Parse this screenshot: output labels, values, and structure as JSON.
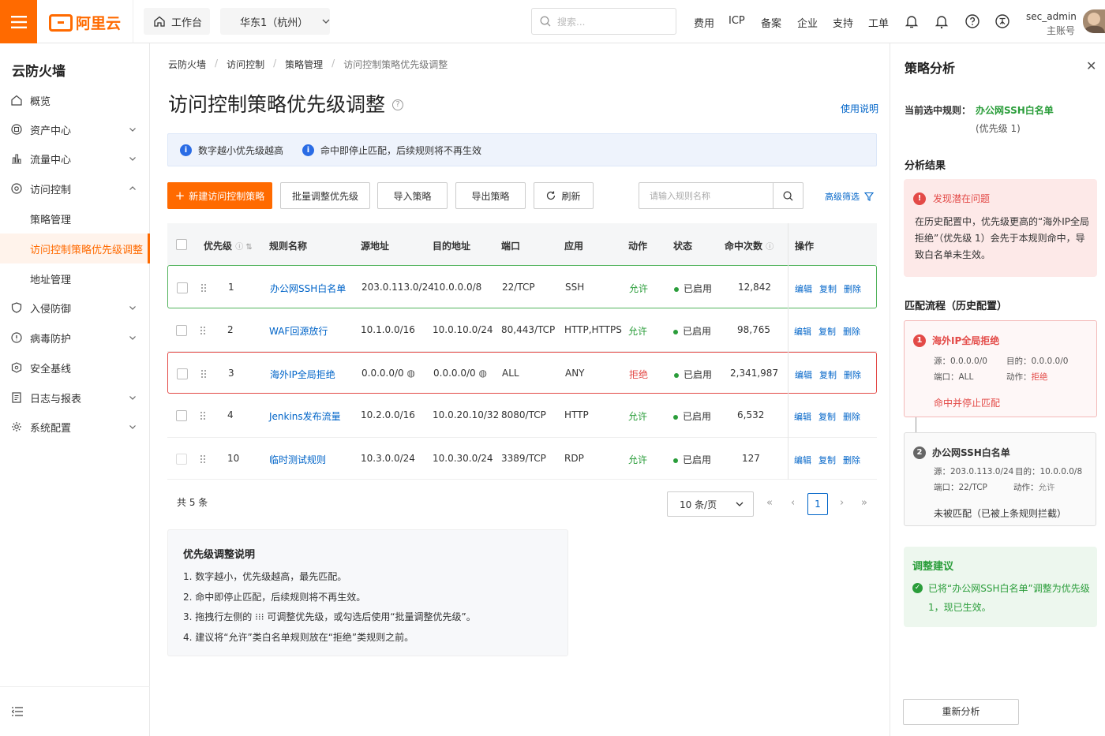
{
  "topbar": {
    "brand": "阿里云",
    "workbench": "工作台",
    "region": "华东1（杭州）",
    "search_placeholder": "搜索...",
    "nav": [
      "费用",
      "ICP",
      "备案",
      "企业",
      "支持",
      "工单"
    ],
    "user_name": "sec_admin",
    "user_role": "主账号"
  },
  "sidebar": {
    "title": "云防火墙",
    "items": [
      {
        "label": "概览",
        "icon": "home-icon"
      },
      {
        "label": "资产中心",
        "icon": "asset-icon"
      },
      {
        "label": "流量中心",
        "icon": "traffic-icon"
      },
      {
        "label": "访问控制",
        "icon": "access-control-icon"
      },
      {
        "label": "策略管理"
      },
      {
        "label": "访问控制策略优先级调整"
      },
      {
        "label": "地址管理"
      },
      {
        "label": "入侵防御",
        "icon": "intrusion-icon"
      },
      {
        "label": "病毒防护",
        "icon": "virus-icon"
      },
      {
        "label": "安全基线",
        "icon": "baseline-icon"
      },
      {
        "label": "日志与报表",
        "icon": "log-icon"
      },
      {
        "label": "系统配置",
        "icon": "settings-icon"
      }
    ]
  },
  "breadcrumb": [
    "云防火墙",
    "访问控制",
    "策略管理",
    "访问控制策略优先级调整"
  ],
  "page": {
    "title": "访问控制策略优先级调整",
    "help_link": "使用说明",
    "notice1": "数字越小优先级越高",
    "notice2": "命中即停止匹配，后续规则将不再生效"
  },
  "toolbar": {
    "new": "新建访问控制策略",
    "batch": "批量调整优先级",
    "import": "导入策略",
    "export": "导出策略",
    "refresh": "刷新",
    "search_placeholder": "请输入规则名称",
    "advanced": "高级筛选"
  },
  "table": {
    "headers": [
      "优先级",
      "规则名称",
      "源地址",
      "目的地址",
      "端口",
      "应用",
      "动作",
      "状态",
      "命中次数",
      "操作"
    ],
    "actions": [
      "编辑",
      "复制",
      "删除"
    ],
    "rows": [
      {
        "priority": "1",
        "name": "办公网SSH白名单",
        "src": "203.0.113.0/24",
        "dst": "10.0.0.0/8",
        "port": "22/TCP",
        "app": "SSH",
        "action": "允许",
        "status": "已启用",
        "hits": "12,842"
      },
      {
        "priority": "2",
        "name": "WAF回源放行",
        "src": "10.1.0.0/16",
        "dst": "10.0.10.0/24",
        "port": "80,443/TCP",
        "app": "HTTP,HTTPS",
        "action": "允许",
        "status": "已启用",
        "hits": "98,765"
      },
      {
        "priority": "3",
        "name": "海外IP全局拒绝",
        "src": "0.0.0.0/0",
        "dst": "0.0.0.0/0",
        "port": "ALL",
        "app": "ANY",
        "action": "拒绝",
        "status": "已启用",
        "hits": "2,341,987"
      },
      {
        "priority": "4",
        "name": "Jenkins发布流量",
        "src": "10.2.0.0/16",
        "dst": "10.0.20.10/32",
        "port": "8080/TCP",
        "app": "HTTP",
        "action": "允许",
        "status": "已启用",
        "hits": "6,532"
      },
      {
        "priority": "10",
        "name": "临时测试规则",
        "src": "10.3.0.0/24",
        "dst": "10.0.30.0/24",
        "port": "3389/TCP",
        "app": "RDP",
        "action": "允许",
        "status": "已启用",
        "hits": "127"
      }
    ]
  },
  "pagination": {
    "total": "共 5 条",
    "page_size": "10 条/页",
    "current": "1"
  },
  "notes": {
    "title": "优先级调整说明",
    "items": [
      "1.  数字越小，优先级越高，最先匹配。",
      "2.  命中即停止匹配，后续规则将不再生效。",
      "3.  拖拽行左侧的 ⁝⁝⁝ 可调整优先级，或勾选后使用“批量调整优先级”。",
      "4.  建议将“允许”类白名单规则放在“拒绝”类规则之前。"
    ]
  },
  "panel": {
    "title": "策略分析",
    "current_label": "当前选中规则：",
    "current_rule": "办公网SSH白名单",
    "current_priority": "(优先级 1)",
    "result_title": "分析结果",
    "warn_title": "发现潜在问题",
    "warn_text": "在历史配置中，优先级更高的“海外IP全局拒绝”（优先级 1）会先于本规则命中，导致白名单未生效。",
    "flow_title": "匹配流程（历史配置）",
    "flow1": {
      "num": "1",
      "name": "海外IP全局拒绝",
      "src": "源：0.0.0.0/0",
      "dst": "目的：0.0.0.0/0",
      "port": "端口：ALL",
      "action_label": "动作：",
      "action": "拒绝",
      "result": "命中并停止匹配"
    },
    "flow2": {
      "num": "2",
      "name": "办公网SSH白名单",
      "src": "源：203.0.113.0/24",
      "dst": "目的：10.0.0.0/8",
      "port": "端口：22/TCP",
      "action_label": "动作：",
      "action": "允许",
      "result": "未被匹配（已被上条规则拦截）"
    },
    "suggest_title": "调整建议",
    "suggest_text1": "已将“办公网SSH白名单”调整为优先级",
    "suggest_text2": "1，现已生效。",
    "reanalyze": "重新分析"
  },
  "colors": {
    "brand": "#ff6a00",
    "link": "#0064c8",
    "allow": "#2a9d3a",
    "deny": "#e34a47"
  }
}
